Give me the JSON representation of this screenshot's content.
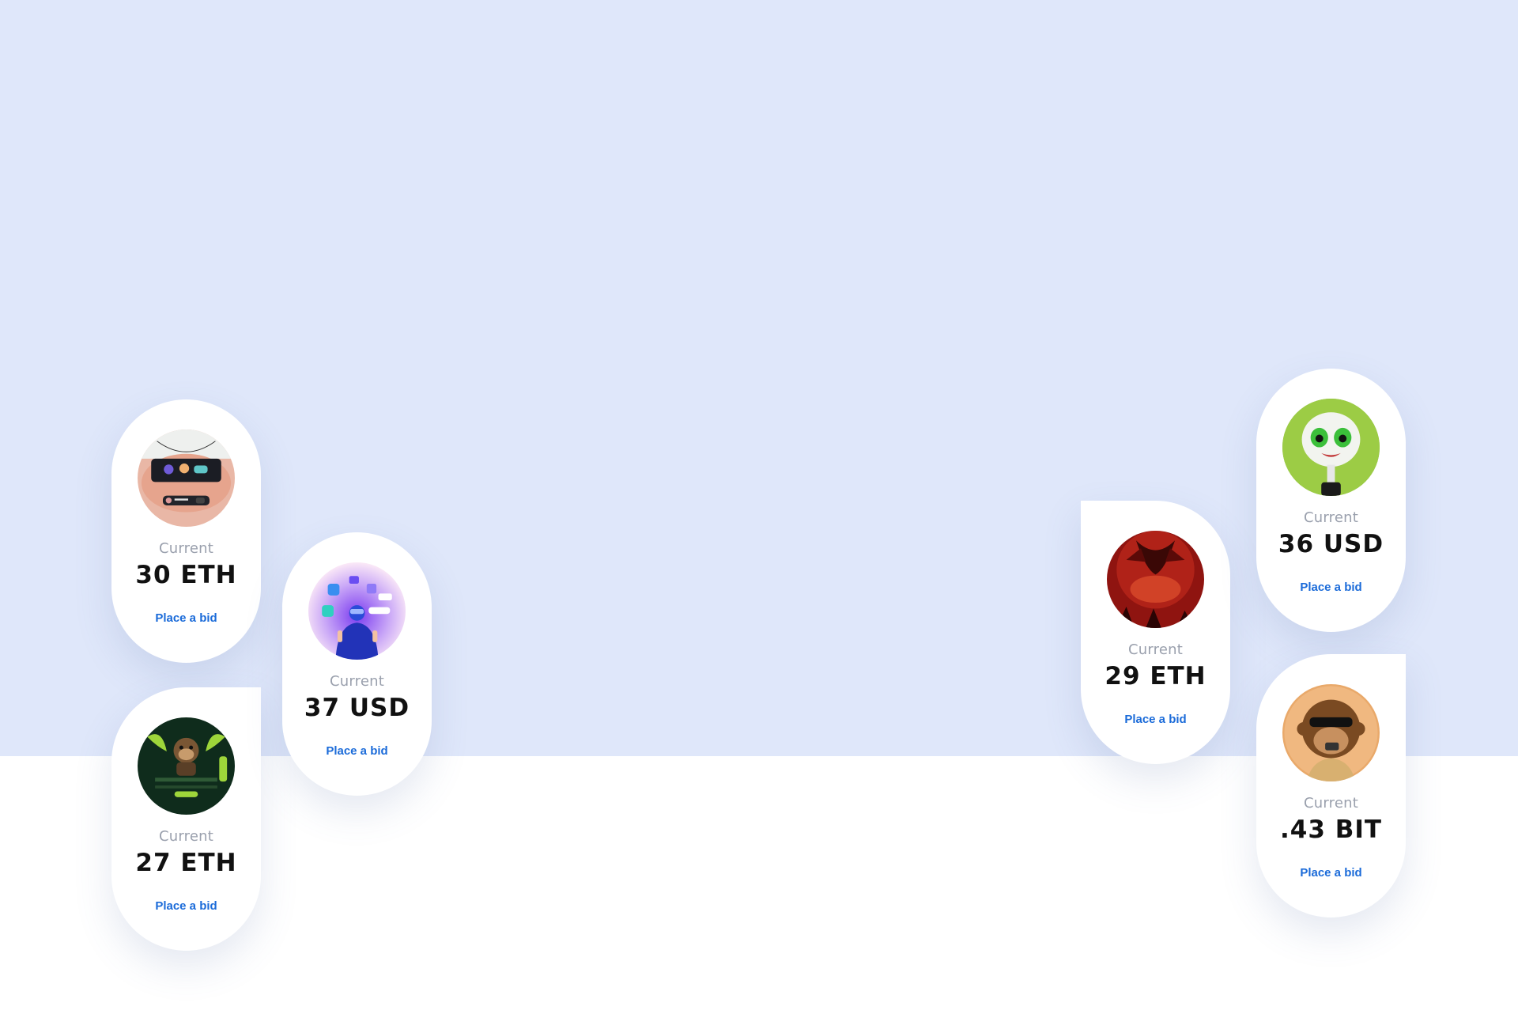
{
  "colors": {
    "hero_background": "#dfe7fa",
    "page_background": "#ffffff",
    "card_background": "#ffffff",
    "label_color": "#9aa0ad",
    "price_color": "#111111",
    "bid_link_color": "#1b6bd9"
  },
  "cards": [
    {
      "thumbnail": "phone-app-image",
      "label": "Current",
      "price": "30 ETH",
      "action": "Place a bid"
    },
    {
      "thumbnail": "ape-dashboard-image",
      "label": "Current",
      "price": "27 ETH",
      "action": "Place a bid"
    },
    {
      "thumbnail": "vr-apps-image",
      "label": "Current",
      "price": "37 USD",
      "action": "Place a bid"
    },
    {
      "thumbnail": "red-demon-image",
      "label": "Current",
      "price": "29 ETH",
      "action": "Place a bid"
    },
    {
      "thumbnail": "green-cartoon-image",
      "label": "Current",
      "price": "36 USD",
      "action": "Place a bid"
    },
    {
      "thumbnail": "bored-ape-image",
      "label": "Current",
      ".43 BIT": null,
      "price": ".43 BIT",
      "action": "Place a bid"
    }
  ]
}
